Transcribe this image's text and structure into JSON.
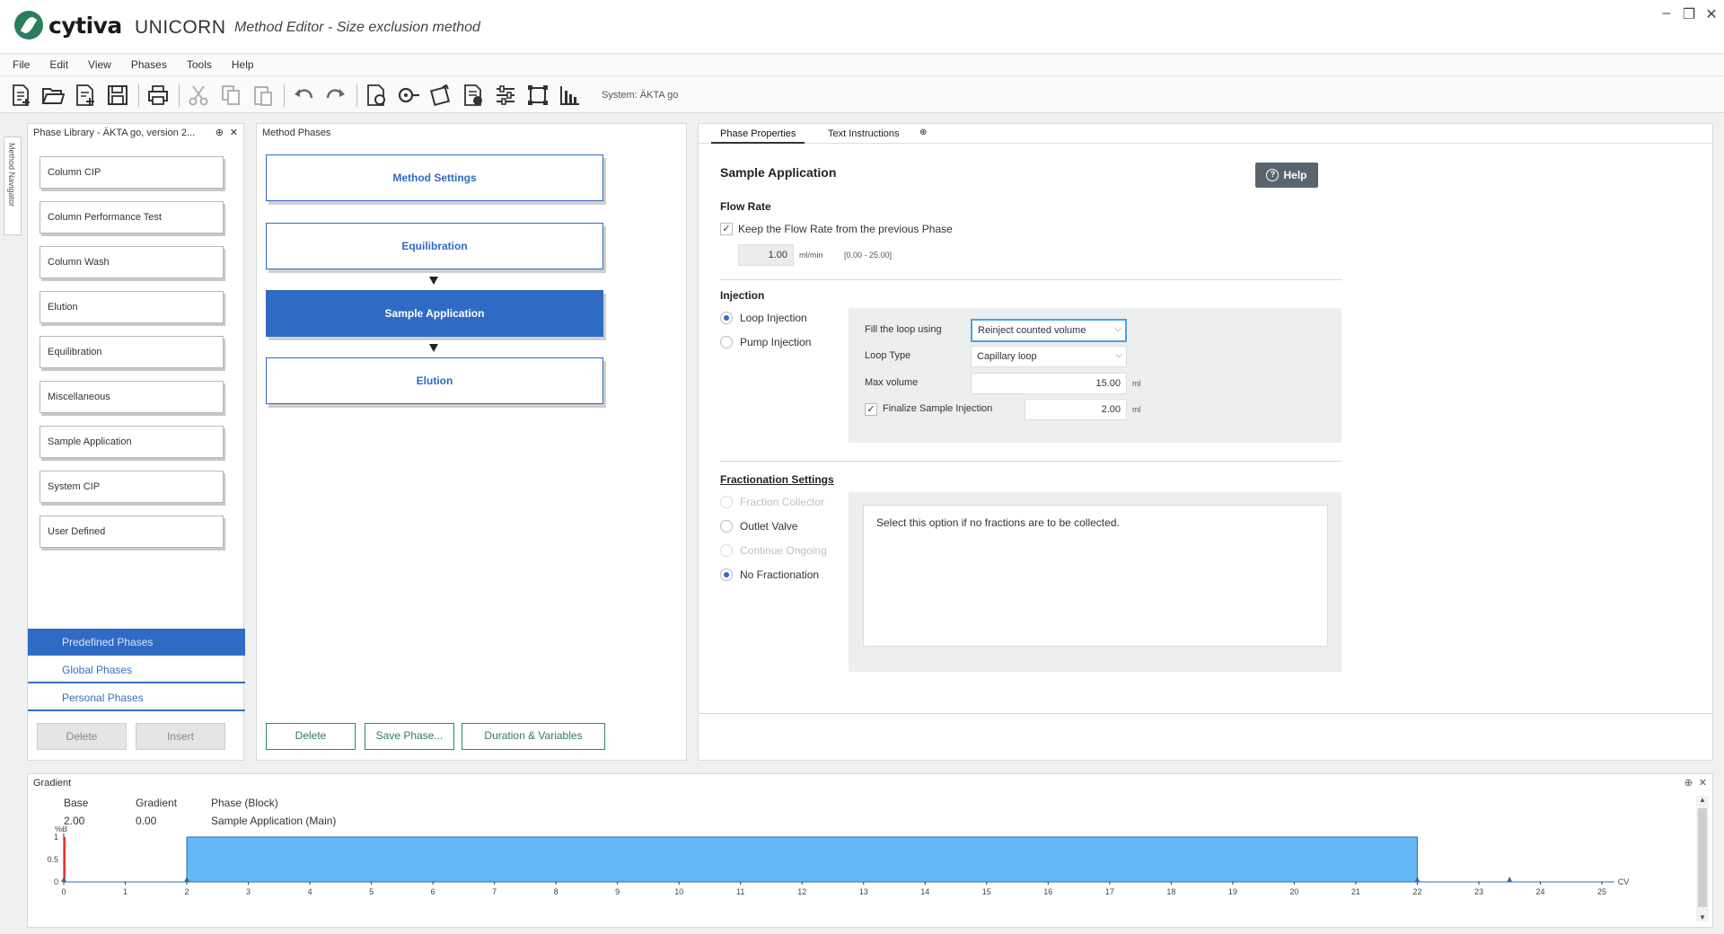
{
  "titlebar": {
    "logo_text": "cytiva",
    "app_name": "UNICORN",
    "doc_title": "Method Editor - Size exclusion method",
    "minimize": "–",
    "maximize": "❐",
    "close": "✕"
  },
  "menu": [
    "File",
    "Edit",
    "View",
    "Phases",
    "Tools",
    "Help"
  ],
  "toolbar": {
    "icons": [
      "new-method-icon",
      "open-icon",
      "save-as-icon",
      "save-icon",
      "print-icon",
      "cut-icon",
      "copy-icon",
      "paste-icon",
      "undo-icon",
      "redo-icon",
      "method-settings-icon",
      "run-icon",
      "gradient-icon",
      "report-icon",
      "settings-icon",
      "crop-icon",
      "chart-icon"
    ],
    "system_label": "System: ÄKTA go"
  },
  "navigator": {
    "label": "Method Navigator"
  },
  "phase_library": {
    "header": "Phase Library - ÄKTA go, version 2...",
    "pin": "⊕",
    "close": "✕",
    "items": [
      "Column CIP",
      "Column Performance Test",
      "Column Wash",
      "Elution",
      "Equilibration",
      "Miscellaneous",
      "Sample Application",
      "System CIP",
      "User Defined"
    ],
    "tabs": [
      "Predefined Phases",
      "Global Phases",
      "Personal Phases"
    ],
    "delete": "Delete",
    "insert": "Insert"
  },
  "method_phases": {
    "header": "Method Phases",
    "blocks": [
      "Method Settings",
      "Equilibration",
      "Sample Application",
      "Elution"
    ],
    "delete": "Delete",
    "save_phase": "Save Phase...",
    "duration": "Duration & Variables"
  },
  "phase_properties": {
    "tabs": [
      "Phase Properties",
      "Text Instructions"
    ],
    "tab_pin": "⊕",
    "title": "Sample Application",
    "help": "Help",
    "flow_rate": {
      "title": "Flow Rate",
      "keep_label": "Keep the Flow Rate from the previous Phase",
      "keep_checked": "✓",
      "value": "1.00",
      "unit": "ml/min",
      "range": "[0.00 - 25.00]"
    },
    "injection": {
      "title": "Injection",
      "loop": "Loop Injection",
      "pump": "Pump Injection",
      "fill_label": "Fill the loop using",
      "fill_value": "Reinject counted volume",
      "loop_type_label": "Loop Type",
      "loop_type_value": "Capillary loop",
      "max_volume_label": "Max volume",
      "max_volume_value": "15.00",
      "max_volume_unit": "ml",
      "finalize_label": "Finalize Sample Injection",
      "finalize_checked": "✓",
      "finalize_value": "2.00",
      "finalize_unit": "ml"
    },
    "fractionation": {
      "title": "Fractionation Settings",
      "options": [
        "Fraction Collector",
        "Outlet Valve",
        "Continue Ongoing",
        "No Fractionation"
      ],
      "info": "Select this option if no fractions are to be collected."
    }
  },
  "gradient": {
    "title": "Gradient",
    "pin": "⊕",
    "close": "✕",
    "base_label": "Base",
    "base_value": "2.00",
    "gradient_label": "Gradient",
    "gradient_value": "0.00",
    "phase_label": "Phase (Block)",
    "phase_value": "Sample Application (Main)",
    "unit_y": "%B",
    "unit_x": "CV",
    "accent": "#64b8f5"
  },
  "chart_data": {
    "type": "area",
    "x_ticks": [
      "0",
      "1",
      "2",
      "3",
      "4",
      "5",
      "6",
      "7",
      "8",
      "9",
      "10",
      "11",
      "12",
      "13",
      "14",
      "15",
      "16",
      "17",
      "18",
      "19",
      "20",
      "21",
      "22",
      "23",
      "24",
      "25"
    ],
    "y_ticks": [
      "1",
      "0.5",
      "0"
    ],
    "xlim": [
      0,
      25
    ],
    "ylim": [
      0,
      1
    ],
    "ylabel": "%B",
    "xlabel": "CV",
    "series": [
      {
        "x": [
          0,
          2,
          2,
          22,
          22,
          25.2
        ],
        "y": [
          0,
          0,
          1,
          1,
          0,
          0
        ]
      }
    ],
    "markers": [
      0,
      2,
      22,
      23.5
    ]
  }
}
